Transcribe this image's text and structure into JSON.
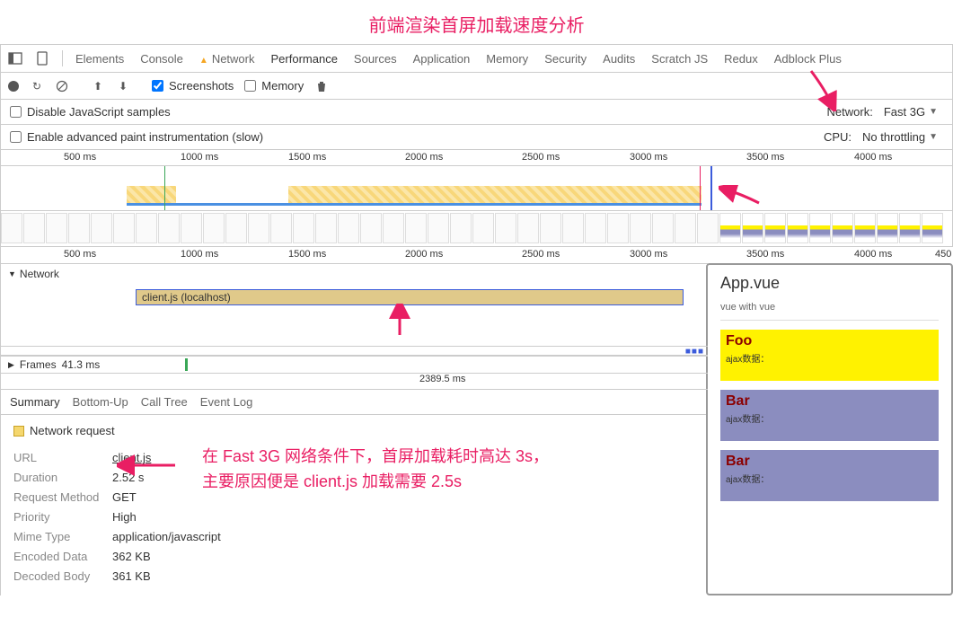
{
  "annotation": {
    "title": "前端渲染首屏加载速度分析",
    "note_line1": "在 Fast 3G 网络条件下，首屏加载耗时高达 3s，",
    "note_line2": "主要原因便是 client.js 加载需要 2.5s"
  },
  "tabs": [
    "Elements",
    "Console",
    "Network",
    "Performance",
    "Sources",
    "Application",
    "Memory",
    "Security",
    "Audits",
    "Scratch JS",
    "Redux",
    "Adblock Plus"
  ],
  "active_tab": "Performance",
  "warn_tab": "Network",
  "subtoolbar": {
    "screenshots_label": "Screenshots",
    "memory_label": "Memory",
    "screenshots_checked": true,
    "memory_checked": false
  },
  "options": {
    "disable_js_label": "Disable JavaScript samples",
    "advanced_paint_label": "Enable advanced paint instrumentation (slow)",
    "network_label": "Network:",
    "network_value": "Fast 3G",
    "cpu_label": "CPU:",
    "cpu_value": "No throttling"
  },
  "ruler_ticks": [
    "500 ms",
    "1000 ms",
    "1500 ms",
    "2000 ms",
    "2500 ms",
    "3000 ms",
    "3500 ms",
    "4000 ms"
  ],
  "ruler2_ticks": [
    "500 ms",
    "1000 ms",
    "1500 ms",
    "2000 ms",
    "2500 ms",
    "3000 ms",
    "3500 ms",
    "4000 ms",
    "450"
  ],
  "network_section_label": "Network",
  "network_bar_label": "client.js (localhost)",
  "frames": {
    "label": "Frames",
    "first_value": "41.3 ms",
    "center_value": "2389.5 ms"
  },
  "detail_tabs": [
    "Summary",
    "Bottom-Up",
    "Call Tree",
    "Event Log"
  ],
  "summary": {
    "title": "Network request",
    "url_label": "URL",
    "url_value": "client.js",
    "duration_label": "Duration",
    "duration_value": "2.52 s",
    "method_label": "Request Method",
    "method_value": "GET",
    "priority_label": "Priority",
    "priority_value": "High",
    "mime_label": "Mime Type",
    "mime_value": "application/javascript",
    "encoded_label": "Encoded Data",
    "encoded_value": "362 KB",
    "decoded_label": "Decoded Body",
    "decoded_value": "361 KB"
  },
  "preview": {
    "title": "App.vue",
    "subtitle": "vue with vue",
    "blocks": [
      {
        "heading": "Foo",
        "sub": "ajax数据：",
        "class": "pb-yellow"
      },
      {
        "heading": "Bar",
        "sub": "ajax数据：",
        "class": "pb-purple"
      },
      {
        "heading": "Bar",
        "sub": "ajax数据：",
        "class": "pb-purple"
      }
    ]
  }
}
